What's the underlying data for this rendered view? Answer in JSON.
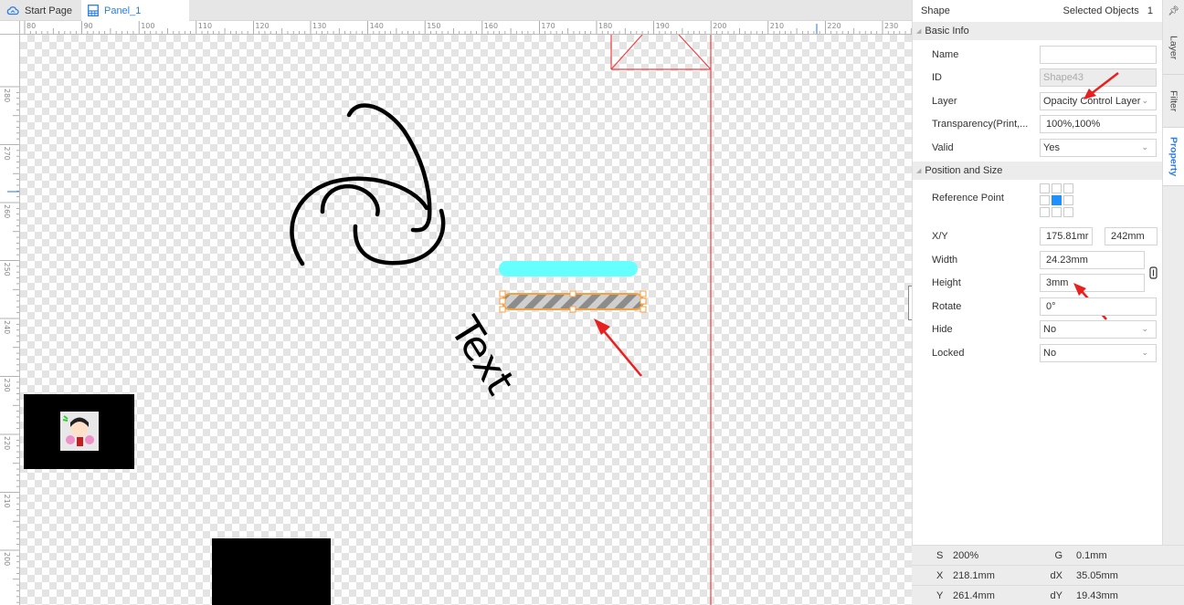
{
  "tabs": [
    {
      "label": "Start Page",
      "icon": "cloud-icon",
      "active": false
    },
    {
      "label": "Panel_1",
      "icon": "panel-icon",
      "active": true
    }
  ],
  "ruler": {
    "top_labels": [
      "80",
      "90",
      "100",
      "110",
      "120",
      "130",
      "140",
      "150",
      "160",
      "170",
      "180",
      "190",
      "200",
      "210",
      "220",
      "230"
    ],
    "left_labels": [
      "280",
      "270",
      "260",
      "250",
      "240",
      "230",
      "220",
      "210",
      "200"
    ]
  },
  "canvas": {
    "text_object": "Text",
    "colors": {
      "guide_lines": "#f04040",
      "cyan_bar": "#66ffff",
      "selection": "#f5a040",
      "hatch_dark": "#8c8c8c",
      "hatch_light": "#cfcfcf"
    }
  },
  "panel": {
    "header_left": "Shape",
    "header_right_label": "Selected Objects",
    "header_right_count": "1",
    "basic_info": {
      "title": "Basic Info",
      "name_label": "Name",
      "name_value": "",
      "id_label": "ID",
      "id_value": "Shape43",
      "layer_label": "Layer",
      "layer_value": "Opacity Control Layer",
      "transparency_label": "Transparency(Print,...",
      "transparency_value": "100%,100%",
      "valid_label": "Valid",
      "valid_value": "Yes"
    },
    "position_size": {
      "title": "Position and Size",
      "ref_label": "Reference Point",
      "ref_selected": "center",
      "xy_label": "X/Y",
      "x_value": "175.81mr",
      "y_value": "242mm",
      "width_label": "Width",
      "width_value": "24.23mm",
      "height_label": "Height",
      "height_value": "3mm",
      "rotate_label": "Rotate",
      "rotate_value": "0°",
      "hide_label": "Hide",
      "hide_value": "No",
      "locked_label": "Locked",
      "locked_value": "No"
    }
  },
  "side_tabs": [
    {
      "label": "Layer",
      "active": false
    },
    {
      "label": "Filter",
      "active": false
    },
    {
      "label": "Property",
      "active": true
    }
  ],
  "status": {
    "s_key": "S",
    "s_val": "200%",
    "g_key": "G",
    "g_val": "0.1mm",
    "x_key": "X",
    "x_val": "218.1mm",
    "dx_key": "dX",
    "dx_val": "35.05mm",
    "y_key": "Y",
    "y_val": "261.4mm",
    "dy_key": "dY",
    "dy_val": "19.43mm"
  }
}
